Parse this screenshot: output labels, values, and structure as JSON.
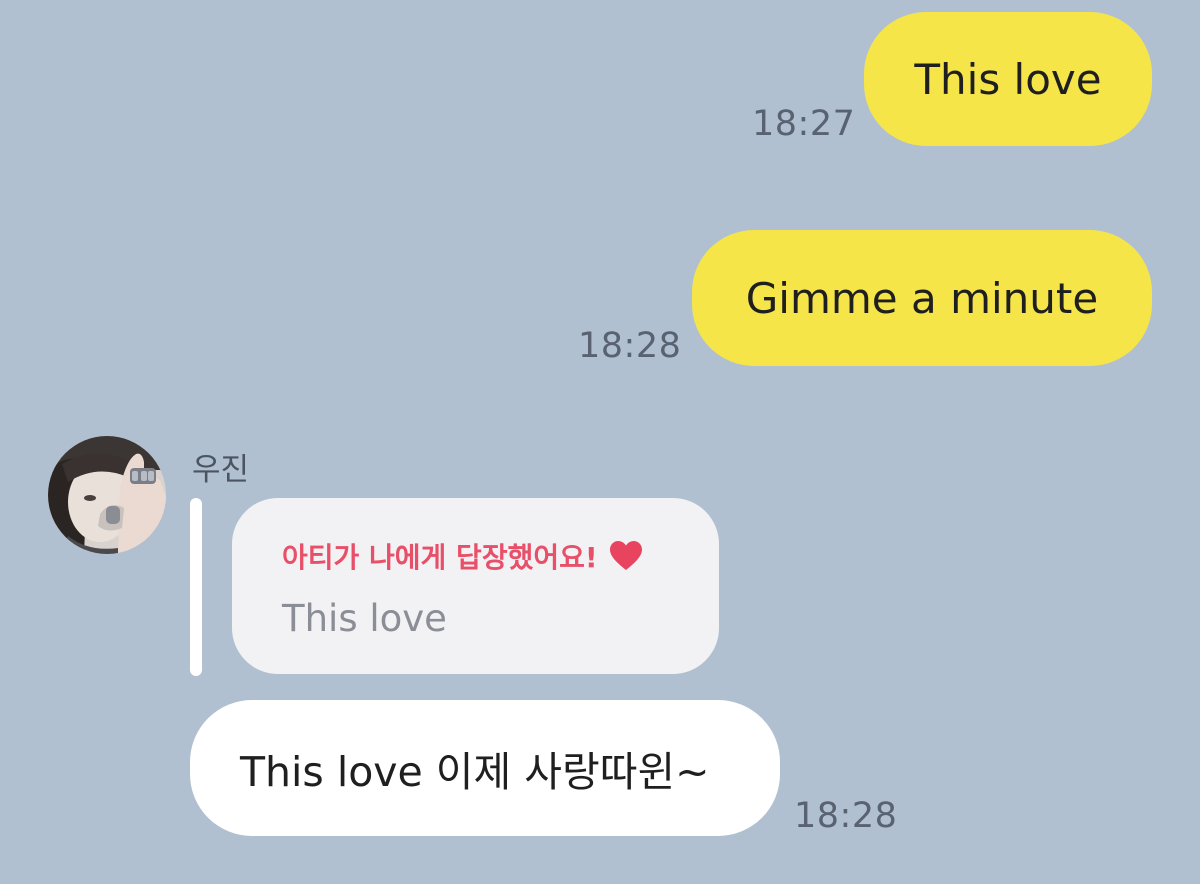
{
  "messages": {
    "sent_1": {
      "text": "This love",
      "time": "18:27"
    },
    "sent_2": {
      "text": "Gimme a minute",
      "time": "18:28"
    },
    "received_1": {
      "sender": "우진",
      "reply": {
        "title": "아티가 나에게 답장했어요!",
        "quoted_text": "This love",
        "icon": "heart-icon"
      },
      "text": "This love 이제 사랑따윈~",
      "time": "18:28"
    }
  },
  "colors": {
    "background": "#b1c0d0",
    "sent_bubble": "#f5e549",
    "received_bubble": "#ffffff",
    "reply_card": "#f2f2f4",
    "reply_accent": "#e85069",
    "timestamp": "#586270"
  }
}
